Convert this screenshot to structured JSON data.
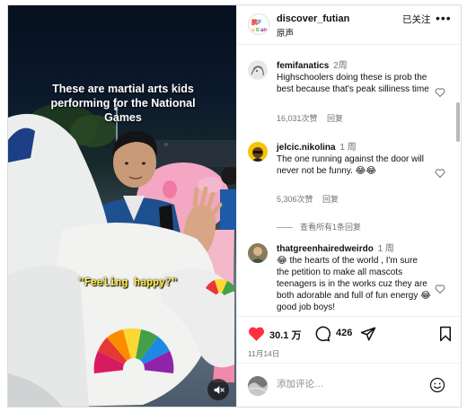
{
  "video": {
    "caption": "These are martial arts kids performing for the National Games",
    "subtitle": "\"Feeling happy?\"",
    "mute_icon": "speaker-muted-icon"
  },
  "post": {
    "username": "discover_futian",
    "subtitle": "原声",
    "follow_status": "已关注",
    "more_icon": "ellipsis-icon"
  },
  "comments": [
    {
      "username": "femifanatics",
      "time": "2周",
      "text": "Highschoolers doing these is prob the best because that's peak silliness time",
      "likes": "16,031次赞",
      "reply_label": "回复"
    },
    {
      "username": "jelcic.nikolina",
      "time": "1 周",
      "text": "The one running against the door will never not be funny. 😂😂",
      "likes": "5,306次赞",
      "reply_label": "回复",
      "view_replies": "查看所有1条回复"
    },
    {
      "username": "thatgreenhairedweirdo",
      "time": "1 周",
      "text": "😂 the hearts of the world , I'm sure the petition to make all mascots teenagers is in the works cuz they are both adorable and full of fun energy 😂 good job boys!",
      "likes": "",
      "reply_label": ""
    }
  ],
  "actions": {
    "like_count": "30.1 万",
    "comment_count": "426",
    "date": "11月14日",
    "like_icon": "heart-filled-icon",
    "comment_icon": "comment-bubble-icon",
    "share_icon": "send-icon",
    "save_icon": "bookmark-icon"
  },
  "composer": {
    "placeholder": "添加评论…",
    "emoji_icon": "smiley-icon"
  },
  "colors": {
    "like_red": "#ff3040",
    "meta_gray": "#737373",
    "subtitle_yellow": "#ffe940"
  }
}
